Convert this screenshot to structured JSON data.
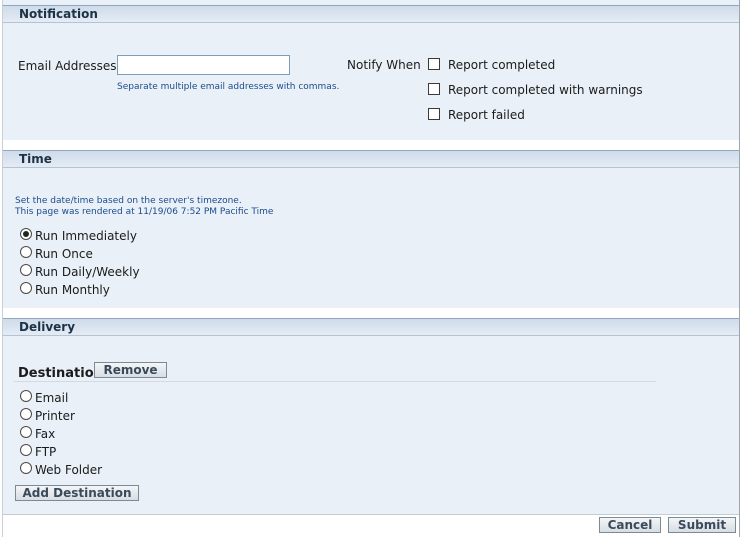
{
  "notification": {
    "header": "Notification",
    "email_label": "Email Addresses",
    "email_value": "",
    "email_hint": "Separate multiple email addresses with commas.",
    "notify_label": "Notify When",
    "options": [
      {
        "label": "Report completed",
        "checked": false
      },
      {
        "label": "Report completed with warnings",
        "checked": false
      },
      {
        "label": "Report failed",
        "checked": false
      }
    ]
  },
  "time": {
    "header": "Time",
    "note1": "Set the date/time based on the server's timezone.",
    "note2": "This page was rendered at 11/19/06 7:52 PM Pacific Time",
    "options": [
      {
        "label": "Run Immediately",
        "selected": true
      },
      {
        "label": "Run Once",
        "selected": false
      },
      {
        "label": "Run Daily/Weekly",
        "selected": false
      },
      {
        "label": "Run Monthly",
        "selected": false
      }
    ]
  },
  "delivery": {
    "header": "Delivery",
    "destination_label": "Destination",
    "remove_label": "Remove",
    "options": [
      {
        "label": "Email",
        "selected": false
      },
      {
        "label": "Printer",
        "selected": false
      },
      {
        "label": "Fax",
        "selected": false
      },
      {
        "label": "FTP",
        "selected": false
      },
      {
        "label": "Web Folder",
        "selected": false
      }
    ],
    "add_label": "Add Destination"
  },
  "footer": {
    "cancel_label": "Cancel",
    "submit_label": "Submit"
  }
}
